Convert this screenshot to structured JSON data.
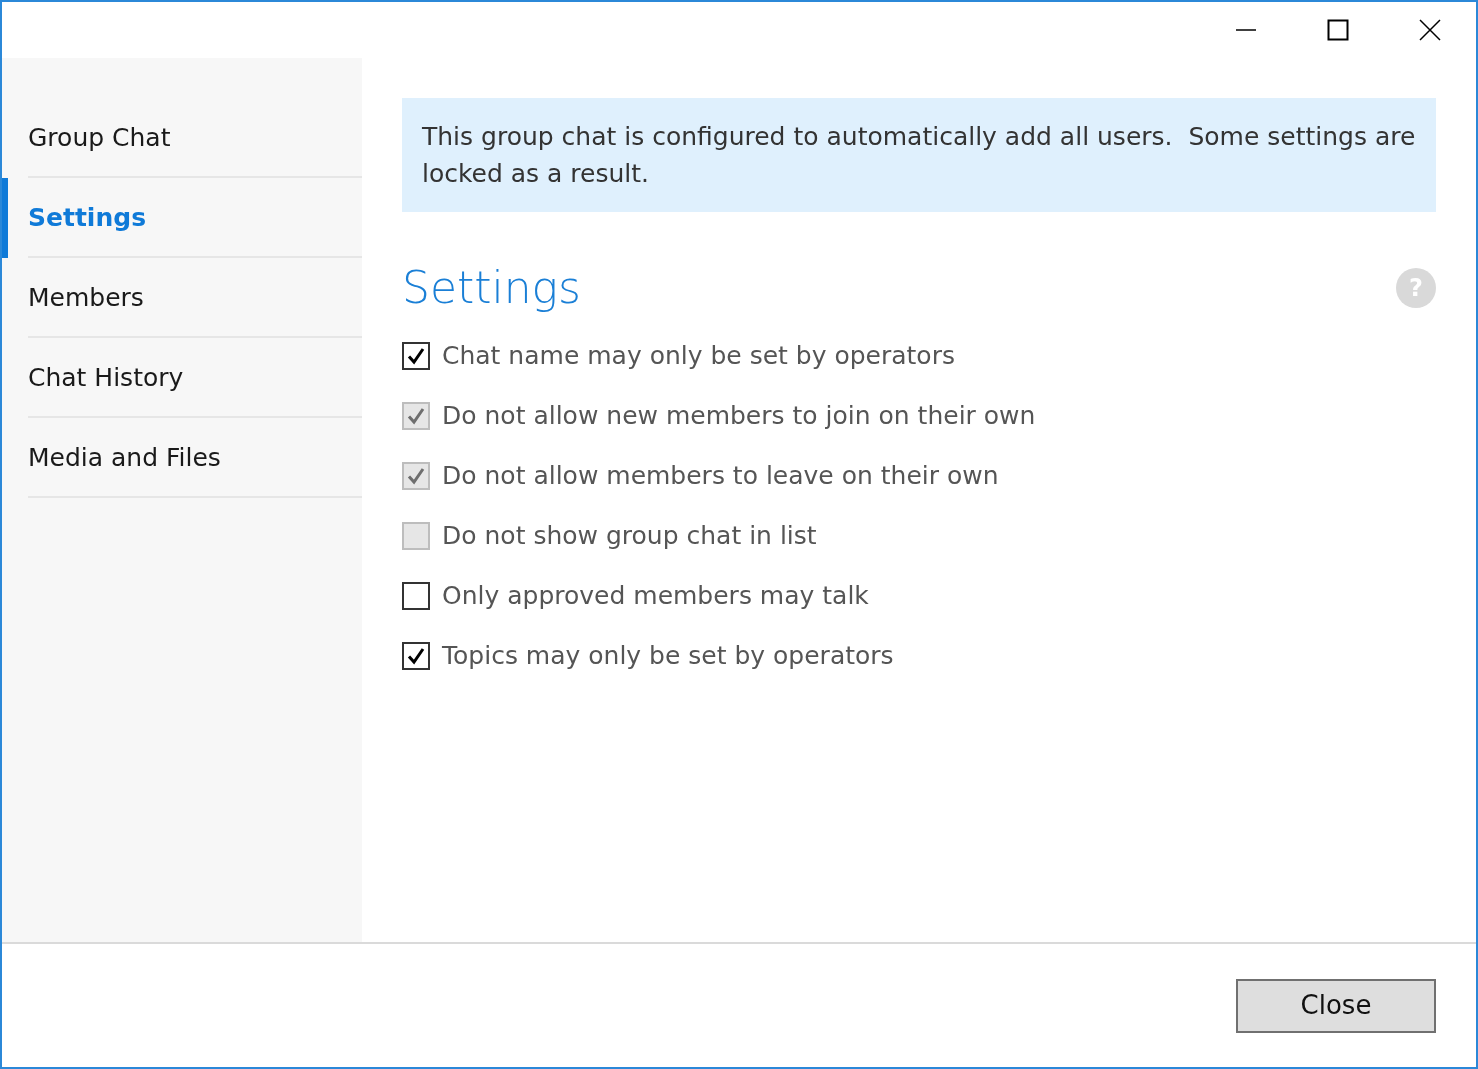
{
  "sidebar": {
    "items": [
      {
        "label": "Group Chat",
        "selected": false
      },
      {
        "label": "Settings",
        "selected": true
      },
      {
        "label": "Members",
        "selected": false
      },
      {
        "label": "Chat History",
        "selected": false
      },
      {
        "label": "Media and Files",
        "selected": false
      }
    ]
  },
  "notice": "This group chat is configured to automatically add all users.  Some settings are locked as a result.",
  "heading": "Settings",
  "help": "?",
  "options": [
    {
      "label": "Chat name may only be set by operators",
      "checked": true,
      "disabled": false
    },
    {
      "label": "Do not allow new members to join on their own",
      "checked": true,
      "disabled": true
    },
    {
      "label": "Do not allow members to leave on their own",
      "checked": true,
      "disabled": true
    },
    {
      "label": "Do not show group chat in list",
      "checked": false,
      "disabled": true
    },
    {
      "label": "Only approved members may talk",
      "checked": false,
      "disabled": false
    },
    {
      "label": "Topics may only be set by operators",
      "checked": true,
      "disabled": false
    }
  ],
  "buttons": [
    "Close"
  ]
}
